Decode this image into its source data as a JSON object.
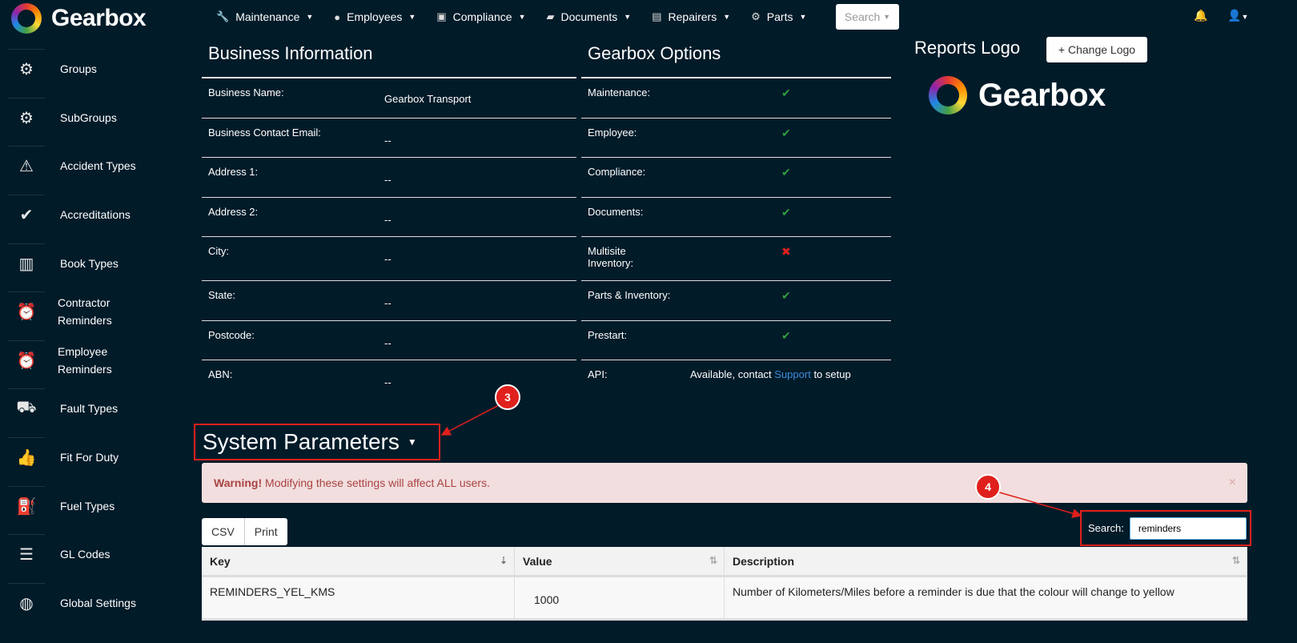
{
  "brand": "Gearbox",
  "nav": [
    {
      "label": "Maintenance",
      "icon": "wrench-icon",
      "glyph": "🔧"
    },
    {
      "label": "Employees",
      "icon": "user-circle-icon",
      "glyph": "●"
    },
    {
      "label": "Compliance",
      "icon": "calendar-check-icon",
      "glyph": "▣"
    },
    {
      "label": "Documents",
      "icon": "folder-open-icon",
      "glyph": "▰"
    },
    {
      "label": "Repairers",
      "icon": "address-book-icon",
      "glyph": "▤"
    },
    {
      "label": "Parts",
      "icon": "cog-icon",
      "glyph": "⚙"
    }
  ],
  "search_label": "Search",
  "sidebar": [
    {
      "label": "Groups",
      "glyph": "⚙"
    },
    {
      "label": "SubGroups",
      "glyph": "⚙"
    },
    {
      "label": "Accident Types",
      "glyph": "⚠"
    },
    {
      "label": "Accreditations",
      "glyph": "✔"
    },
    {
      "label": "Book Types",
      "glyph": "▥"
    },
    {
      "label": "Contractor Reminders",
      "glyph": "⏰"
    },
    {
      "label": "Employee Reminders",
      "glyph": "⏰"
    },
    {
      "label": "Fault Types",
      "glyph": "⛟"
    },
    {
      "label": "Fit For Duty",
      "glyph": "👍"
    },
    {
      "label": "Fuel Types",
      "glyph": "⛽"
    },
    {
      "label": "GL Codes",
      "glyph": "☰"
    },
    {
      "label": "Global Settings",
      "glyph": "◍"
    }
  ],
  "business": {
    "title": "Business Information",
    "rows": [
      {
        "key": "Business Name:",
        "value": "Gearbox Transport"
      },
      {
        "key": "Business Contact Email:",
        "value": "--"
      },
      {
        "key": "Address 1:",
        "value": "--"
      },
      {
        "key": "Address 2:",
        "value": "--"
      },
      {
        "key": "City:",
        "value": "--"
      },
      {
        "key": "State:",
        "value": "--"
      },
      {
        "key": "Postcode:",
        "value": "--"
      },
      {
        "key": "ABN:",
        "value": "--"
      }
    ]
  },
  "options": {
    "title": "Gearbox Options",
    "rows": [
      {
        "key": "Maintenance:",
        "value": "✔",
        "status": "enabled"
      },
      {
        "key": "Employee:",
        "value": "✔",
        "status": "enabled"
      },
      {
        "key": "Compliance:",
        "value": "✔",
        "status": "enabled"
      },
      {
        "key": "Documents:",
        "value": "✔",
        "status": "enabled"
      },
      {
        "key": "Multisite Inventory:",
        "value": "✖",
        "status": "disabled"
      },
      {
        "key": "Parts & Inventory:",
        "value": "✔",
        "status": "enabled"
      },
      {
        "key": "Prestart:",
        "value": "✔",
        "status": "enabled"
      }
    ],
    "api": {
      "key": "API:",
      "prefix": "Available, contact ",
      "link": "Support",
      "suffix": " to setup"
    }
  },
  "reports_logo": {
    "title": "Reports Logo",
    "button": "+  Change Logo"
  },
  "system_parameters": {
    "title": "System Parameters",
    "warning_bold": "Warning!",
    "warning_text": " Modifying these settings will affect ALL users.",
    "close": "×",
    "buttons": [
      "CSV",
      "Print"
    ],
    "search_label": "Search:",
    "search_value": "reminders",
    "columns": [
      "Key",
      "Value",
      "Description"
    ],
    "rows": [
      {
        "key": "REMINDERS_YEL_KMS",
        "value": "1000",
        "description": "Number of Kilometers/Miles before a reminder is due that the colour will change to yellow"
      }
    ]
  },
  "annotations": [
    "3",
    "4"
  ]
}
